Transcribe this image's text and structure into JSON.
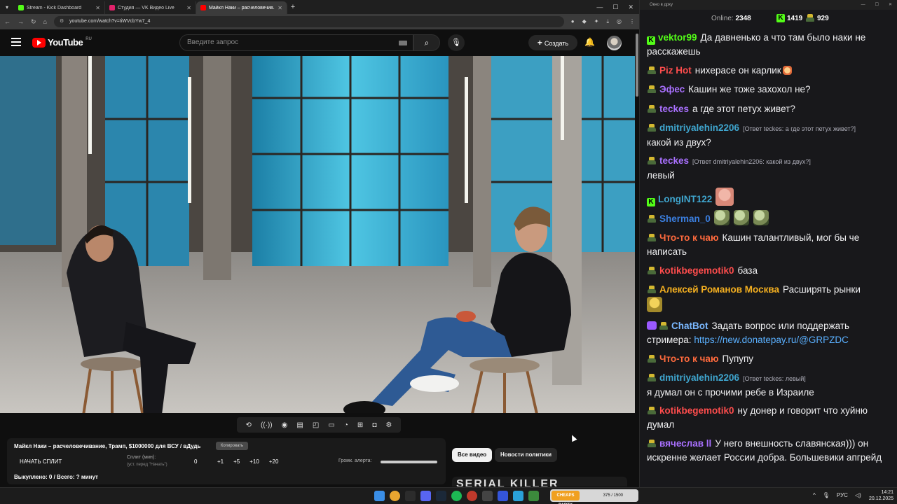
{
  "browser": {
    "tabs": [
      {
        "label": "Stream - Kick Dashboard",
        "color": "#53fc18"
      },
      {
        "label": "Студия — VK Видео Live",
        "color": "#e3226b"
      },
      {
        "label": "Майкл Наки – расчеловечив...",
        "color": "#ff0000"
      }
    ],
    "url": "youtube.com/watch?v=tiWVcbYw7_4"
  },
  "youtube": {
    "logo_text": "YouTube",
    "region": "RU",
    "search_placeholder": "Введите запрос",
    "create_label": "Создать"
  },
  "panel": {
    "title": "Майкл Наки – расчеловечивание, Трамп, $1000000 для ВСУ / вДудь",
    "copy_label": "Копировать",
    "start_split": "НАЧАТЬ СПЛИТ",
    "split_min": "Сплит (мин):",
    "split_hint": "(уст. перед \"Начать\")",
    "split_value": "0",
    "increments": [
      "+1",
      "+5",
      "+10",
      "+20"
    ],
    "alert_volume": "Громк. алерта:",
    "bought": "Выкуплено: 0 / Всего: ? минут"
  },
  "chips": {
    "all": "Все видео",
    "politics": "Новости политики"
  },
  "next_video_title": "SERIAL KILLER",
  "chat": {
    "window_title": "Окно в дрку",
    "online_label": "Online:",
    "online_count": "2348",
    "kick_count": "1419",
    "vk_count": "929",
    "messages": [
      {
        "user": "vektor99",
        "color": "#53fc18",
        "badge": "kick",
        "text": "Да давненько а что там было наки не расскажешь"
      },
      {
        "user": "Piz Hot",
        "color": "#ff4d4d",
        "badge": "vk",
        "text": "нихерасе он карлик"
      },
      {
        "user": "Эфес",
        "color": "#a970ff",
        "badge": "vk",
        "text": "Кашин же тоже захохол не?"
      },
      {
        "user": "teckes",
        "color": "#a970ff",
        "badge": "vk",
        "text": "а где этот петух живет?"
      },
      {
        "user": "dmitriyalehin2206",
        "color": "#3fa6cf",
        "badge": "vk",
        "reply": "[Ответ teckes: а где этот петух живет?]",
        "text": "какой из двух?"
      },
      {
        "user": "teckes",
        "color": "#a970ff",
        "badge": "vk",
        "reply": "[Ответ dmitriyalehin2206: какой из двух?]",
        "text": "левый"
      },
      {
        "user": "LongINT122",
        "color": "#3fa6cf",
        "badge": "kick",
        "text": ""
      },
      {
        "user": "Sherman_0",
        "color": "#3b7fe0",
        "badge": "vk",
        "text": ""
      },
      {
        "user": "Что-то к чаю",
        "color": "#ff6a3d",
        "badge": "vk",
        "text": "Кашин талантливый, мог бы че написать"
      },
      {
        "user": "kotikbegemotik0",
        "color": "#ff4d4d",
        "badge": "vk",
        "text": "база"
      },
      {
        "user": "Алексей Романов Москва",
        "color": "#f5b020",
        "badge": "vk",
        "text": "Расширять рынки"
      },
      {
        "user": "ChatBot",
        "color": "#7ab8ff",
        "badge": "bot",
        "text": "Задать вопрос или поддержать стримера:",
        "link": "https://new.donatepay.ru/@GRPZDC"
      },
      {
        "user": "Что-то к чаю",
        "color": "#ff6a3d",
        "badge": "vk",
        "text": "Пупупу"
      },
      {
        "user": "dmitriyalehin2206",
        "color": "#3fa6cf",
        "badge": "vk",
        "reply": "[Ответ teckes: левый]",
        "text": "я думал он с прочими ребе в Израиле"
      },
      {
        "user": "kotikbegemotik0",
        "color": "#ff4d4d",
        "badge": "vk",
        "text": "ну донер и говорит что хуйню думал"
      },
      {
        "user": "вячеслав ll",
        "color": "#a970ff",
        "badge": "vk",
        "text": "У него внешность славянская))) он искренне желает России добра. Большевики апгрейд"
      }
    ]
  },
  "taskbar": {
    "media_text": "375 / 1500",
    "media_logo": "CHEAPS PARTY",
    "lang": "РУС",
    "time": "14:21",
    "date": "20.12.2025"
  }
}
